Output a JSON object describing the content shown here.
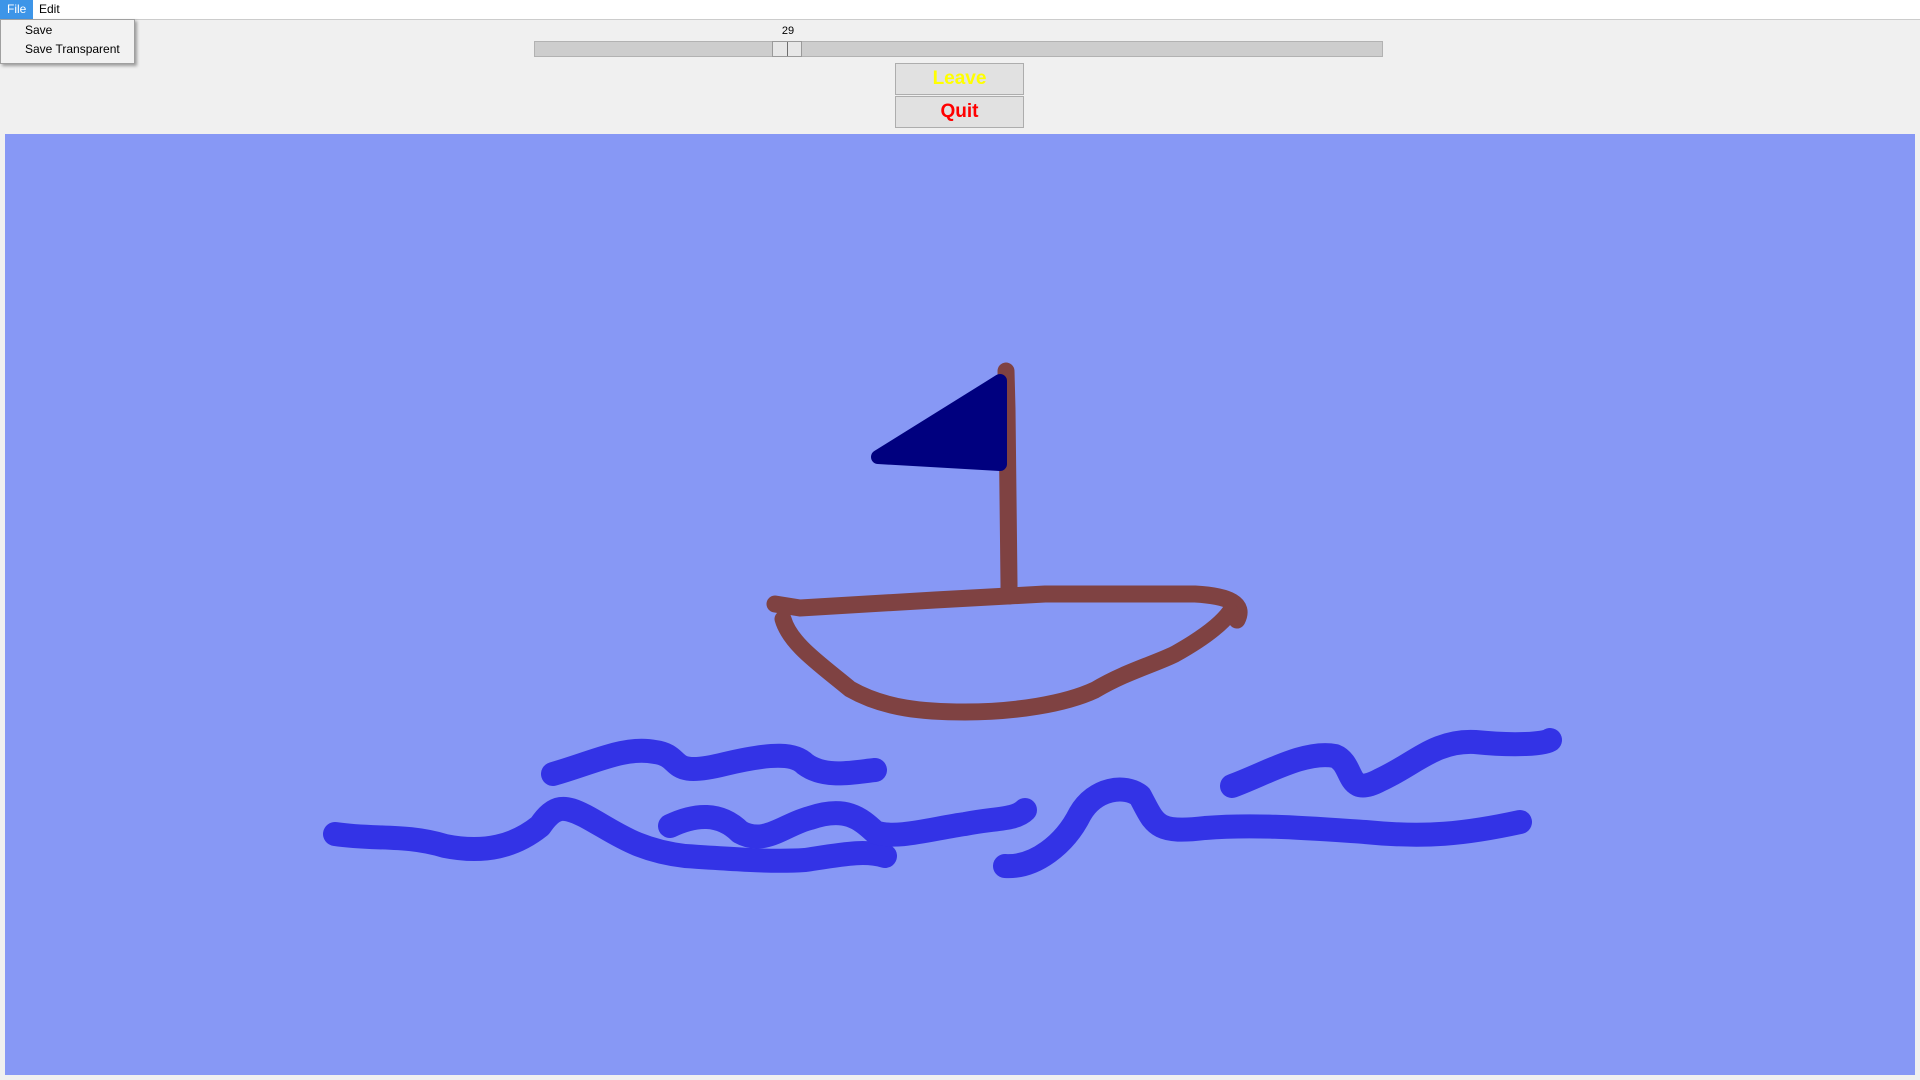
{
  "menubar": {
    "file_label": "File",
    "edit_label": "Edit"
  },
  "file_menu": {
    "open": true,
    "items": [
      {
        "label": "Save"
      },
      {
        "label": "Save Transparent"
      }
    ]
  },
  "slider": {
    "value": 29,
    "value_text": "29",
    "min": 0,
    "max": 100
  },
  "buttons": {
    "leave_label": "Leave",
    "leave_color": "#ffff00",
    "quit_label": "Quit",
    "quit_color": "#ff0000"
  },
  "canvas": {
    "background": "#8798f5",
    "drawing": {
      "boat_color": "#7f4242",
      "sail_color": "#00007f",
      "wave_color": "#3333e6",
      "description_icons": [
        "boat-hull",
        "mast",
        "sail",
        "waves"
      ]
    }
  },
  "colors": {
    "menu_highlight": "#3d95e8",
    "window_bg": "#f0f0f0"
  }
}
